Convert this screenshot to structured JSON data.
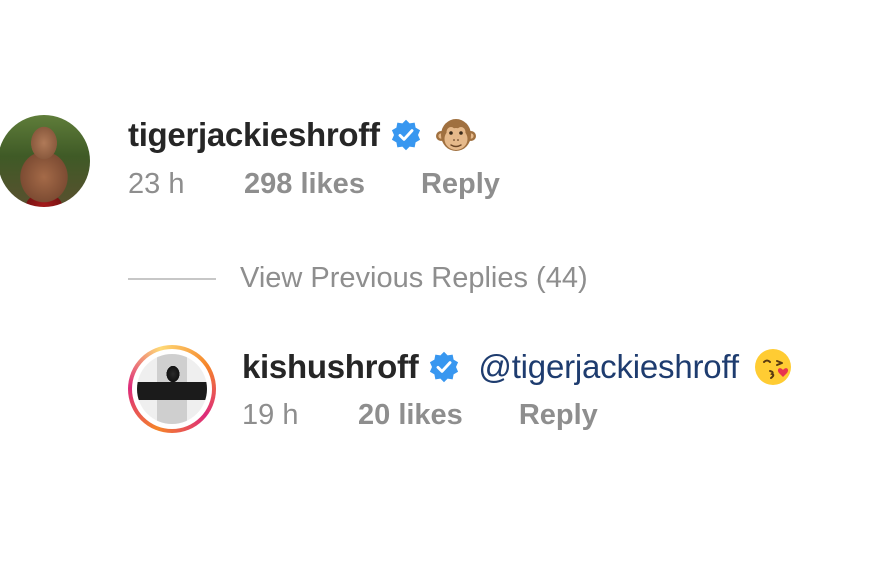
{
  "comments": [
    {
      "username": "tigerjackieshroff",
      "verified": true,
      "emoji_icon": "monkey-emoji",
      "time": "23 h",
      "likes": "298 likes",
      "reply": "Reply"
    },
    {
      "username": "kishushroff",
      "verified": true,
      "mention": "@tigerjackieshroff",
      "emoji_icon": "kissing-face-emoji",
      "time": "19 h",
      "likes": "20 likes",
      "reply": "Reply"
    }
  ],
  "view_previous": "View Previous Replies (44)",
  "colors": {
    "verified_badge": "#3897f0",
    "mention": "#1e3c6f",
    "meta_text": "#8e8e8e",
    "username": "#262626"
  }
}
